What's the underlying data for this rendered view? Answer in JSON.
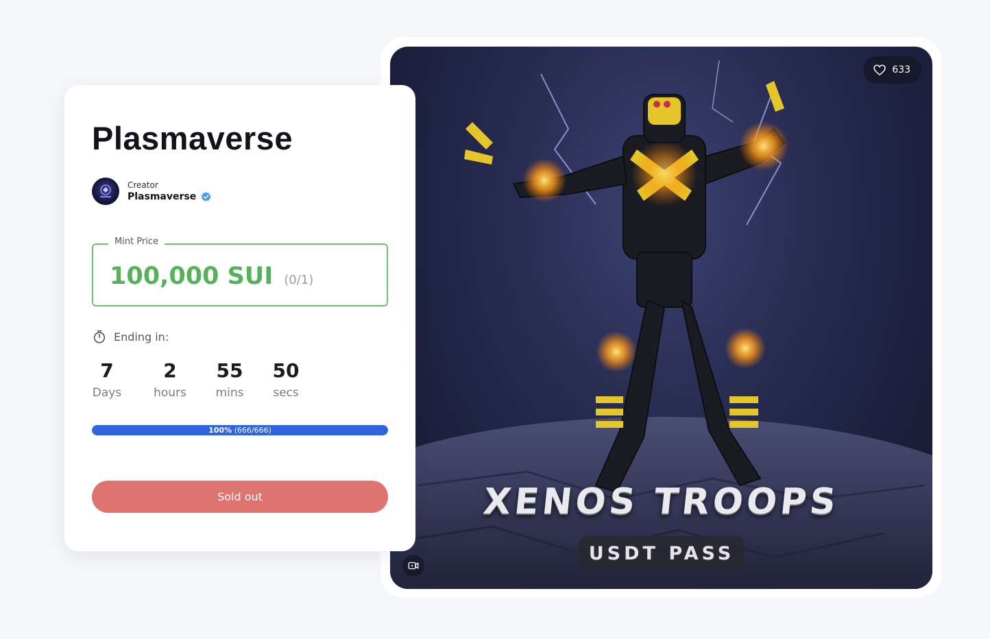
{
  "collection": {
    "title": "Plasmaverse",
    "creator_label": "Creator",
    "creator_name": "Plasmaverse"
  },
  "mint": {
    "label": "Mint Price",
    "price": "100,000 SUI",
    "count": "(0/1)"
  },
  "ending": {
    "label": "Ending in:"
  },
  "countdown": [
    {
      "value": "7",
      "label": "Days"
    },
    {
      "value": "2",
      "label": "hours"
    },
    {
      "value": "55",
      "label": "mins"
    },
    {
      "value": "50",
      "label": "secs"
    }
  ],
  "progress": {
    "percent_text": "100%",
    "count_text": "(666/666)",
    "fraction": 1.0
  },
  "action": {
    "button_label": "Sold out"
  },
  "artwork": {
    "likes": "633",
    "title": "XENOS TROOPS",
    "subtitle": "USDT PASS"
  },
  "colors": {
    "accent_green": "#56b15a",
    "progress_blue": "#2f63e0",
    "button_red": "#de7470"
  },
  "icons": [
    "heart-icon",
    "video-icon",
    "timer-icon",
    "verified-icon",
    "avatar-logo-icon"
  ]
}
